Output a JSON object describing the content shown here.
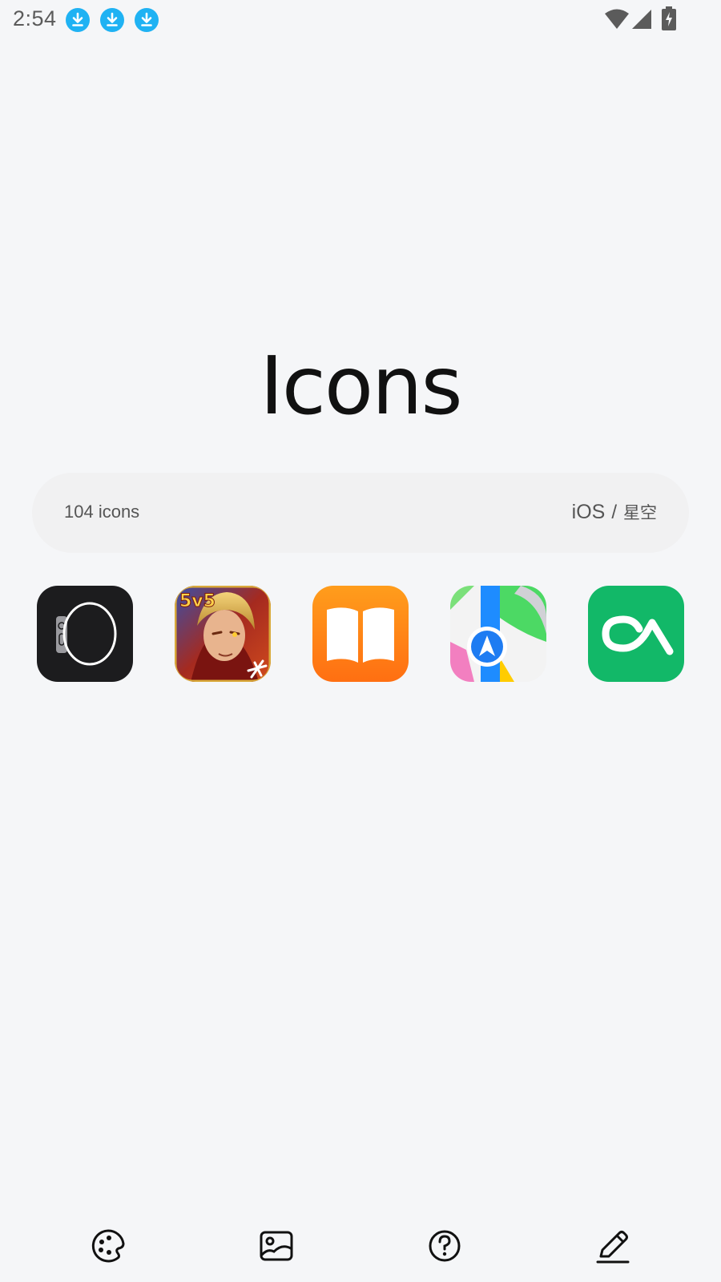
{
  "status_bar": {
    "time": "2:54",
    "notification_icons": [
      "download-icon",
      "download-icon",
      "download-icon"
    ],
    "right_icons": [
      "wifi-icon",
      "cellular-signal-icon",
      "battery-charging-icon"
    ]
  },
  "header": {
    "title": "Icons"
  },
  "summary": {
    "count_label": "104 icons",
    "theme_platform": "iOS",
    "theme_separator": "/",
    "theme_name": "星空"
  },
  "icons": [
    {
      "name": "watch-app-icon",
      "bg": "#1c1c1e"
    },
    {
      "name": "honor-of-kings-app-icon",
      "badge": "5v5",
      "bg": "#b42a20"
    },
    {
      "name": "books-app-icon",
      "bg": "#ff8a14"
    },
    {
      "name": "maps-app-icon",
      "bg": "#f3f3f3"
    },
    {
      "name": "green-ca-app-icon",
      "bg": "#12b868"
    }
  ],
  "bottom_nav": [
    {
      "name": "palette-icon"
    },
    {
      "name": "wallpaper-image-icon"
    },
    {
      "name": "help-question-icon"
    },
    {
      "name": "edit-pencil-icon"
    }
  ],
  "colors": {
    "background": "#f5f6f8",
    "pill": "#f1f1f2",
    "download_badge": "#1fb2f3",
    "text_secondary": "#555555"
  }
}
